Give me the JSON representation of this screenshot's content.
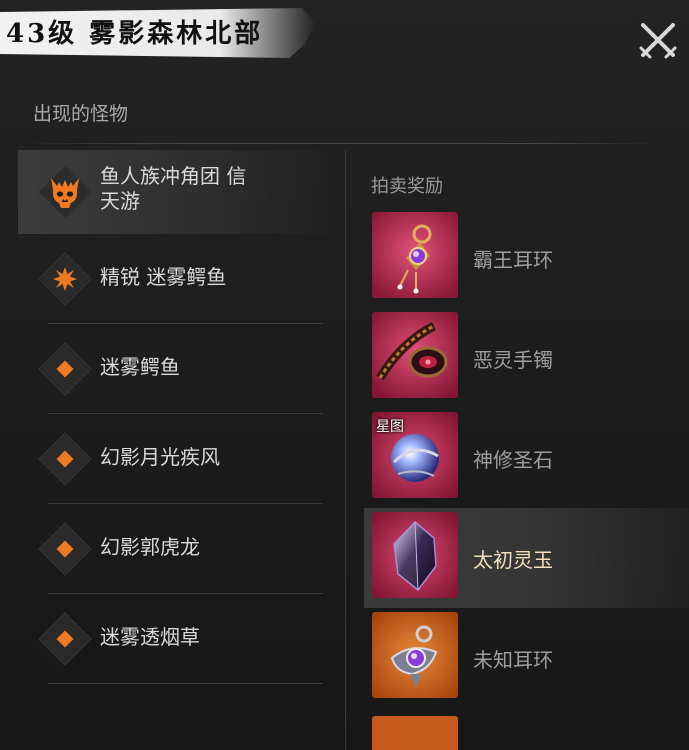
{
  "title": "43级 雾影森林北部",
  "close_icon": "close-x-icon",
  "monsters_heading": "出现的怪物",
  "monsters": [
    {
      "name_line1": "鱼人族冲角团 信",
      "name_line2": "天游",
      "icon": "demon-skull-icon",
      "tier": "boss",
      "selected": true
    },
    {
      "name": "精锐 迷雾鳄鱼",
      "icon": "spiky-star-icon",
      "tier": "elite"
    },
    {
      "name": "迷雾鳄鱼",
      "icon": "diamond-icon",
      "tier": "normal"
    },
    {
      "name": "幻影月光疾风",
      "icon": "diamond-icon",
      "tier": "normal"
    },
    {
      "name": "幻影郭虎龙",
      "icon": "diamond-icon",
      "tier": "normal"
    },
    {
      "name": "迷雾透烟草",
      "icon": "diamond-icon",
      "tier": "normal"
    }
  ],
  "rewards_heading": "拍卖奖励",
  "rewards": [
    {
      "name": "霸王耳环",
      "icon": "earring-icon",
      "rarity_color": "#b8284e"
    },
    {
      "name": "恶灵手镯",
      "icon": "bracelet-icon",
      "rarity_color": "#b8284e"
    },
    {
      "name": "神修圣石",
      "icon": "orb-icon",
      "rarity_color": "#b8284e",
      "tag": "星图"
    },
    {
      "name": "太初灵玉",
      "icon": "crystal-icon",
      "rarity_color": "#b8284e",
      "selected": true
    },
    {
      "name": "未知耳环",
      "icon": "earring-icon",
      "rarity_color": "#c65a1c"
    }
  ],
  "colors": {
    "accent_orange": "#f07a22",
    "rarity_red": "#b8284e",
    "rarity_orange": "#c65a1c",
    "selected_text": "#f2e1b8"
  }
}
